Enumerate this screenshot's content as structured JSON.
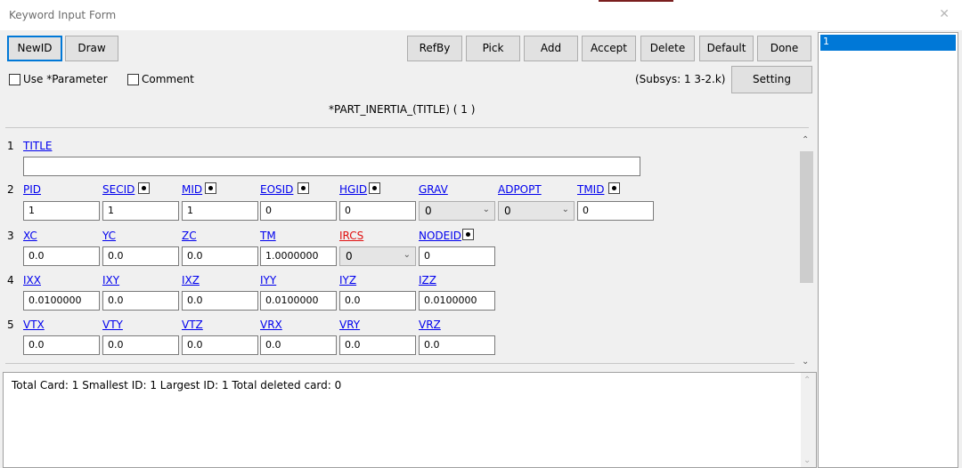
{
  "window": {
    "title": "Keyword Input Form",
    "close_glyph": "✕"
  },
  "toolbar": {
    "newid": "NewID",
    "draw": "Draw",
    "refby": "RefBy",
    "pick": "Pick",
    "add": "Add",
    "accept": "Accept",
    "delete": "Delete",
    "default": "Default",
    "done": "Done",
    "setting": "Setting"
  },
  "options": {
    "use_parameter": "Use *Parameter",
    "comment": "Comment"
  },
  "subsys": "(Subsys: 1 3-2.k)",
  "keyword_title": "*PART_INERTIA_(TITLE)   ( 1 )",
  "cards": {
    "c1": {
      "num": "1",
      "labels": [
        "TITLE"
      ],
      "values": [
        ""
      ]
    },
    "c2": {
      "num": "2",
      "labels": [
        "PID",
        "SECID",
        "MID",
        "EOSID",
        "HGID",
        "GRAV",
        "ADPOPT",
        "TMID"
      ],
      "values": [
        "1",
        "1",
        "1",
        "0",
        "0",
        "0",
        "0",
        "0"
      ]
    },
    "c3": {
      "num": "3",
      "labels": [
        "XC",
        "YC",
        "ZC",
        "TM",
        "IRCS",
        "NODEID"
      ],
      "values": [
        "0.0",
        "0.0",
        "0.0",
        "1.0000000",
        "0",
        "0"
      ]
    },
    "c4": {
      "num": "4",
      "labels": [
        "IXX",
        "IXY",
        "IXZ",
        "IYY",
        "IYZ",
        "IZZ"
      ],
      "values": [
        "0.0100000",
        "0.0",
        "0.0",
        "0.0100000",
        "0.0",
        "0.0100000"
      ]
    },
    "c5": {
      "num": "5",
      "labels": [
        "VTX",
        "VTY",
        "VTZ",
        "VRX",
        "VRY",
        "VRZ"
      ],
      "values": [
        "0.0",
        "0.0",
        "0.0",
        "0.0",
        "0.0",
        "0.0"
      ]
    }
  },
  "status": "Total Card: 1    Smallest ID: 1   Largest ID: 1   Total deleted card:  0",
  "id_list": [
    "1"
  ],
  "colors": {
    "accent": "#0078d7",
    "link": "#0000ee",
    "required": "#e01010"
  }
}
